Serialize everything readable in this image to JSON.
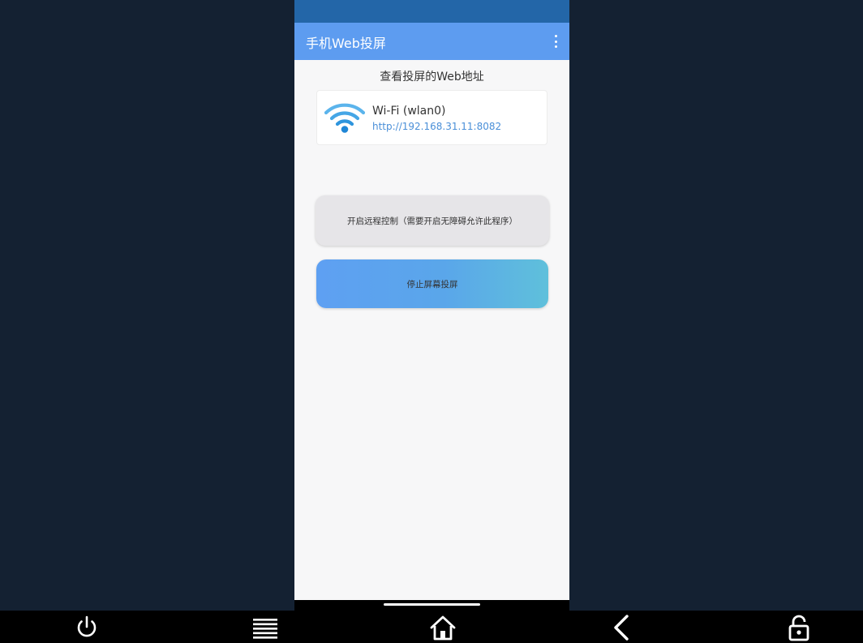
{
  "app": {
    "title": "手机Web投屏"
  },
  "main": {
    "section_title": "查看投屏的Web地址",
    "wifi": {
      "name": "Wi-Fi (wlan0)",
      "url": "http://192.168.31.11:8082"
    },
    "buttons": {
      "remote_control": "开启远程控制（需要开启无障碍允许此程序）",
      "stop_cast": "停止屏幕投屏"
    }
  },
  "controlbar": {
    "icons": [
      "power-icon",
      "menu-icon",
      "home-icon",
      "back-icon",
      "lock-icon"
    ]
  },
  "colors": {
    "appbar": "#5d9cf0",
    "statusbar": "#2366a8",
    "background": "#142132",
    "link": "#4a8fd8"
  }
}
